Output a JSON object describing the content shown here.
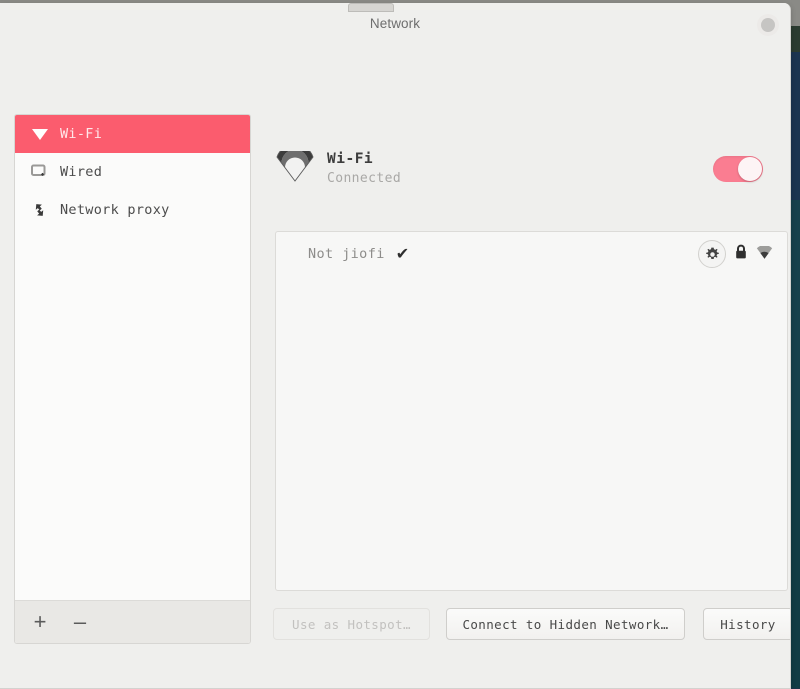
{
  "window": {
    "title": "Network",
    "close_icon": "close-circle-icon",
    "tab_stub": "window-tab-stub"
  },
  "sidebar": {
    "items": [
      {
        "label": "Wi-Fi",
        "icon": "wifi-icon",
        "selected": true
      },
      {
        "label": "Wired",
        "icon": "wired-monitor-icon",
        "selected": false
      },
      {
        "label": "Network proxy",
        "icon": "proxy-arrows-icon",
        "selected": false
      }
    ],
    "footer": {
      "add_label": "+",
      "remove_label": "–"
    }
  },
  "device": {
    "icon": "wifi-signal-icon",
    "name": "Wi-Fi",
    "status": "Connected",
    "toggle": {
      "state": "on",
      "track_color": "#fa7d91",
      "knob_color": "#fdf4f5"
    }
  },
  "networks": [
    {
      "ssid": "Not jiofi",
      "connected_check": "✔",
      "settings_icon": "gear-icon",
      "secure_icon": "lock-icon",
      "signal_icon": "wifi-signal-icon"
    }
  ],
  "actions": {
    "hotspot": {
      "label": "Use as Hotspot…",
      "disabled": true
    },
    "hidden": {
      "label": "Connect to Hidden Network…",
      "disabled": false
    },
    "history": {
      "label": "History",
      "disabled": false
    }
  },
  "colors": {
    "accent": "#fb5c6e",
    "toggle_on": "#fa7d91",
    "window_bg": "#efefed",
    "sidebar_bg": "#fbfbfa",
    "panel_bg": "#f7f7f6"
  }
}
